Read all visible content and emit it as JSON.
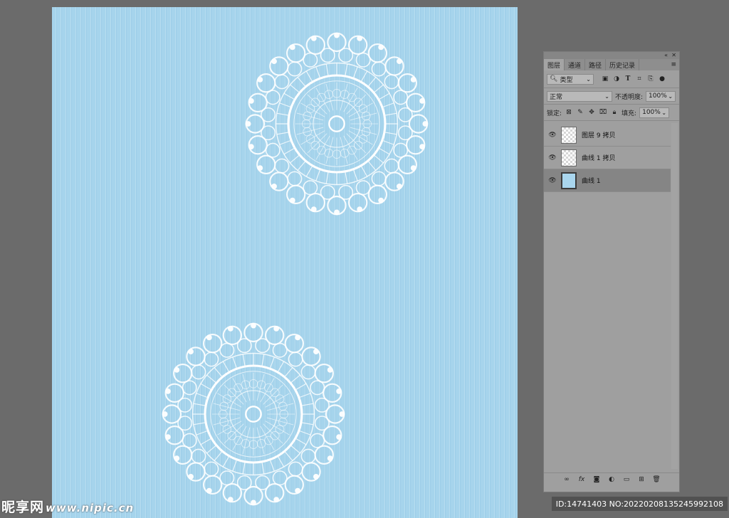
{
  "panel": {
    "titlebar_controls": [
      "«",
      "✕"
    ],
    "tabs": [
      "图层",
      "通道",
      "路径",
      "历史记录"
    ],
    "filter": {
      "value": "类型",
      "icons": [
        "image-filter-icon",
        "adjustment-filter-icon",
        "type-filter-icon",
        "shape-filter-icon",
        "smart-object-filter-icon"
      ]
    },
    "blend_mode": "正常",
    "opacity_label": "不透明度:",
    "opacity_value": "100%",
    "lock_label": "锁定:",
    "fill_label": "填充:",
    "fill_value": "100%",
    "layers": [
      {
        "name": "图层 9 拷贝",
        "visible": true,
        "thumb": "transparent"
      },
      {
        "name": "曲线 1 拷贝",
        "visible": true,
        "thumb": "transparent"
      },
      {
        "name": "曲线 1",
        "visible": true,
        "thumb": "blue",
        "selected": true
      }
    ]
  },
  "watermark": {
    "site": "昵享网",
    "url": "www.nipic.cn",
    "id_text": "ID:14741403 NO:20220208135245992108"
  },
  "colors": {
    "canvas_blue": "#a6d4ec",
    "doily": "#ffffff",
    "app_background": "#6b6b6b",
    "panel": "#9f9f9f"
  }
}
